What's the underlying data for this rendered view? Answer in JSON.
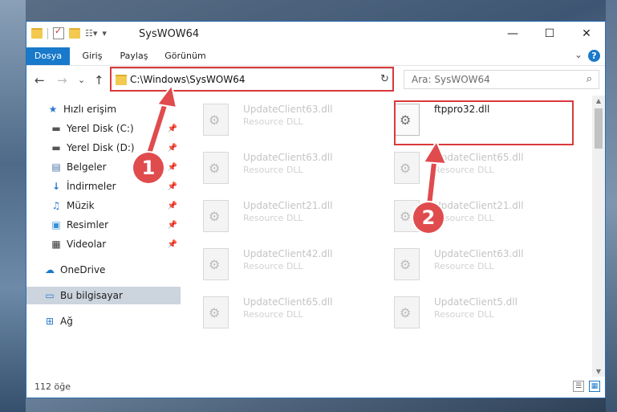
{
  "window": {
    "title": "SysWOW64"
  },
  "window_controls": {
    "minimize": "—",
    "maximize": "☐",
    "close": "✕"
  },
  "ribbon": {
    "tabs": [
      {
        "label": "Dosya"
      },
      {
        "label": "Giriş"
      },
      {
        "label": "Paylaş"
      },
      {
        "label": "Görünüm"
      }
    ],
    "help": "?"
  },
  "nav": {
    "back": "←",
    "forward": "→",
    "recent": "⌄",
    "up": "↑",
    "address": "C:\\Windows\\SysWOW64",
    "refresh": "↻",
    "search_placeholder": "Ara: SysWOW64"
  },
  "sidebar": {
    "items": [
      {
        "label": "Hızlı erişim",
        "icon": "star-icon",
        "pinned": false
      },
      {
        "label": "Yerel Disk (C:)",
        "icon": "drive-icon",
        "pinned": true
      },
      {
        "label": "Yerel Disk (D:)",
        "icon": "drive-icon",
        "pinned": true
      },
      {
        "label": "Belgeler",
        "icon": "documents-icon",
        "pinned": true
      },
      {
        "label": "İndirmeler",
        "icon": "download-icon",
        "pinned": true
      },
      {
        "label": "Müzik",
        "icon": "music-icon",
        "pinned": true
      },
      {
        "label": "Resimler",
        "icon": "pictures-icon",
        "pinned": true
      },
      {
        "label": "Videolar",
        "icon": "videos-icon",
        "pinned": true
      },
      {
        "label": "OneDrive",
        "icon": "cloud-icon",
        "pinned": false
      },
      {
        "label": "Bu bilgisayar",
        "icon": "computer-icon",
        "pinned": false,
        "selected": true
      },
      {
        "label": "Ağ",
        "icon": "network-icon",
        "pinned": false
      }
    ]
  },
  "files": [
    {
      "name": "UpdateClient63.dll",
      "desc": "Resource DLL"
    },
    {
      "name": "ftppro32.dll",
      "desc": "",
      "highlighted": true
    },
    {
      "name": "UpdateClient63.dll",
      "desc": "Resource DLL"
    },
    {
      "name": "UpdateClient65.dll",
      "desc": "Resource DLL"
    },
    {
      "name": "UpdateClient21.dll",
      "desc": "Resource DLL"
    },
    {
      "name": "UpdateClient21.dll",
      "desc": "Resource DLL"
    },
    {
      "name": "UpdateClient42.dll",
      "desc": "Resource DLL"
    },
    {
      "name": "UpdateClient63.dll",
      "desc": "Resource DLL"
    },
    {
      "name": "UpdateClient65.dll",
      "desc": "Resource DLL"
    },
    {
      "name": "UpdateClient5.dll",
      "desc": "Resource DLL"
    }
  ],
  "status": {
    "count": "112 öğe"
  },
  "annotations": {
    "step1": "1",
    "step2": "2",
    "highlight_color": "#d9393b"
  }
}
